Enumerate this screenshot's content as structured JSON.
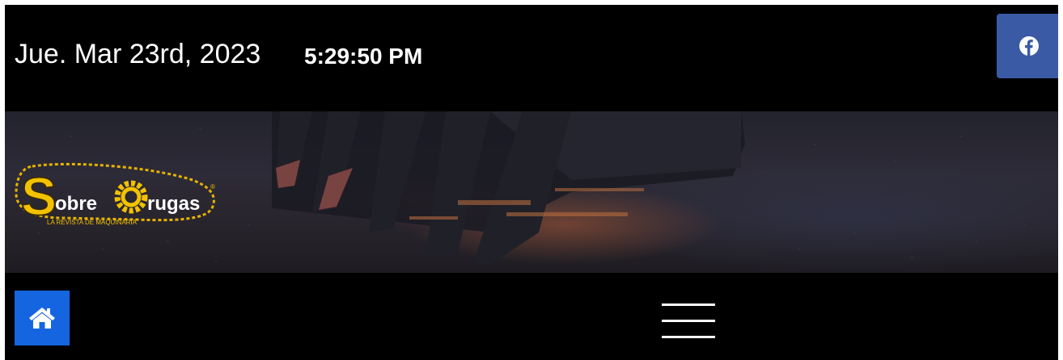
{
  "header": {
    "date": "Jue. Mar 23rd, 2023",
    "time": "5:29:50 PM",
    "social": {
      "icon": "facebook-icon",
      "color": "#3b5aa5"
    }
  },
  "banner": {
    "logo": {
      "text_part1": "obre",
      "text_part2": "rugas",
      "tagline": "LA REVISTA DE MAQUINARIA"
    }
  },
  "nav": {
    "home": {
      "icon": "home-icon",
      "color": "#1565e0"
    },
    "menu": {
      "icon": "hamburger-menu-icon"
    }
  }
}
